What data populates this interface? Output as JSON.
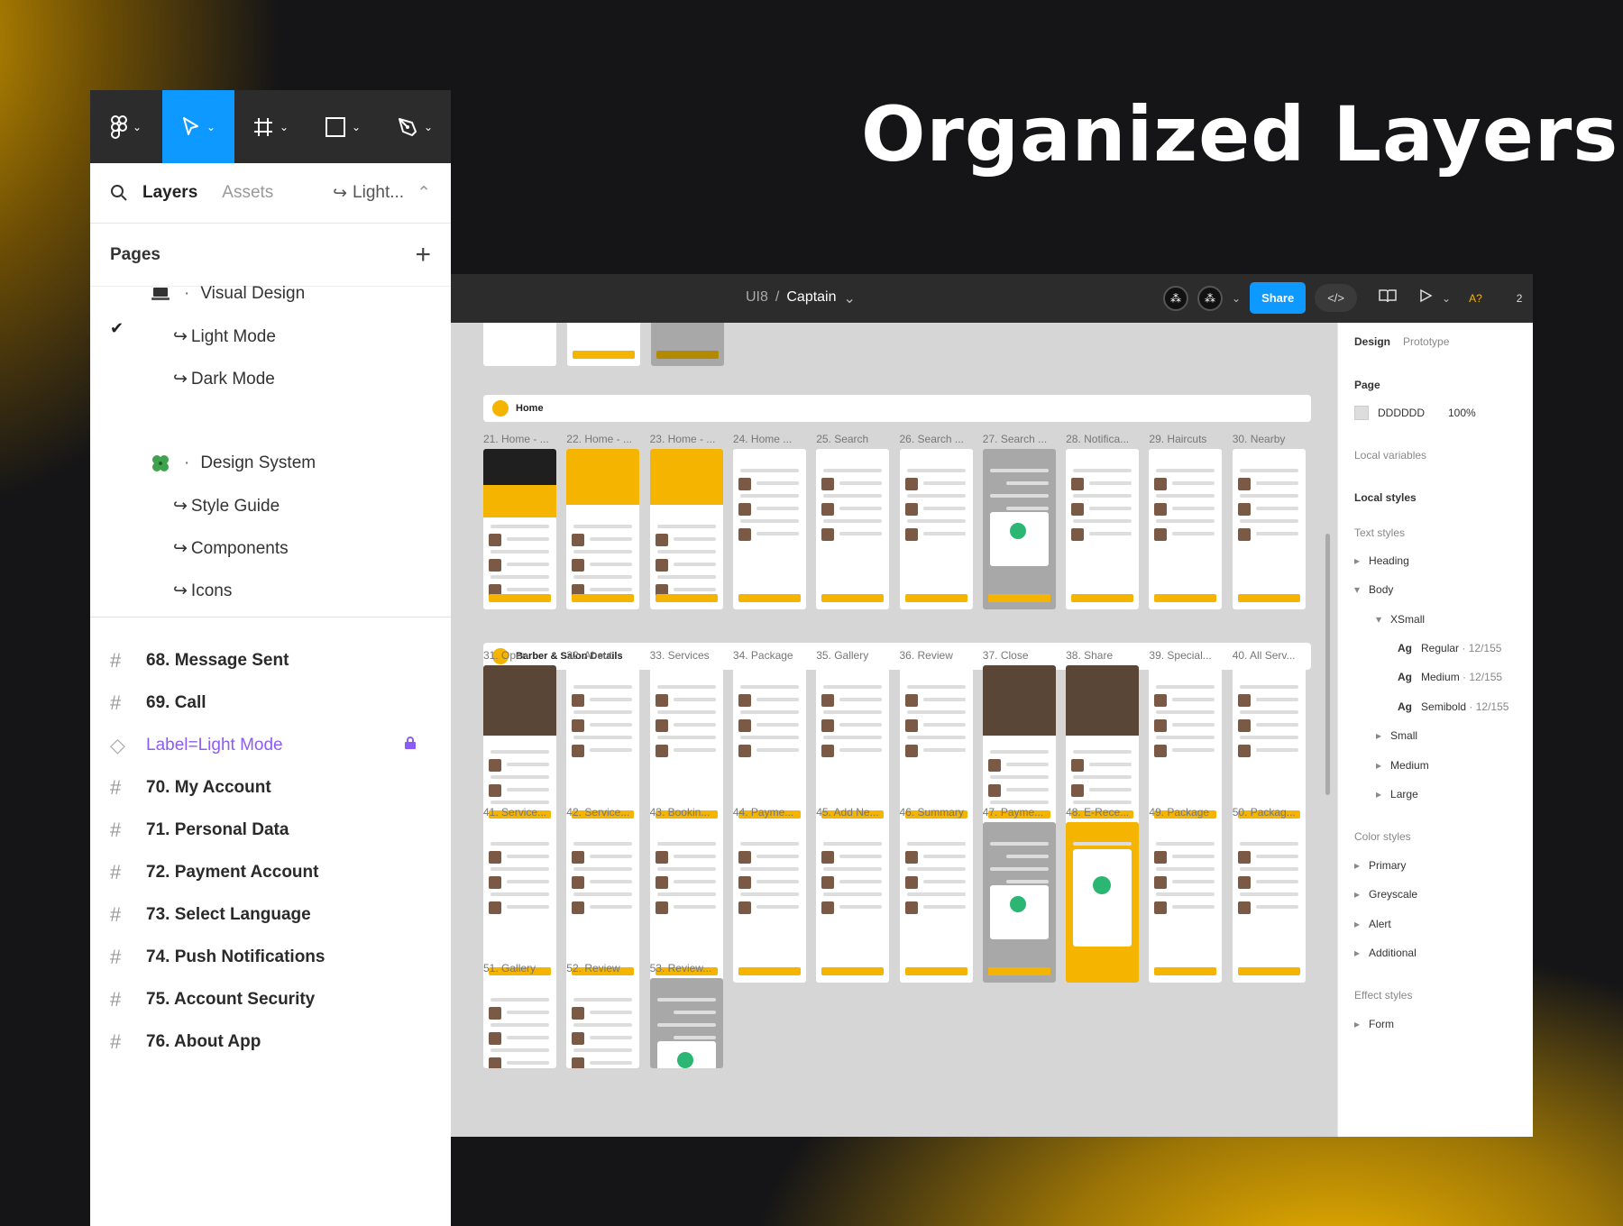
{
  "headline": "Organized Layers",
  "panel": {
    "tabs": {
      "layers": "Layers",
      "assets": "Assets",
      "page": "Light..."
    },
    "pages_title": "Pages",
    "pages": [
      {
        "label": "Visual Design",
        "kind": "group"
      },
      {
        "label": "Light Mode",
        "kind": "sub",
        "checked": true
      },
      {
        "label": "Dark Mode",
        "kind": "sub"
      },
      {
        "label": "Design System",
        "kind": "group"
      },
      {
        "label": "Style Guide",
        "kind": "sub"
      },
      {
        "label": "Components",
        "kind": "sub"
      },
      {
        "label": "Icons",
        "kind": "sub"
      }
    ],
    "layers": [
      "68. Message Sent",
      "69. Call",
      "Label=Light Mode",
      "70. My Account",
      "71. Personal Data",
      "72. Payment Account",
      "73. Select Language",
      "74. Push Notifications",
      "75. Account Security",
      "76. About App"
    ]
  },
  "window": {
    "crumb_team": "UI8",
    "crumb_file": "Captain",
    "share": "Share",
    "code": "</>",
    "zoom_tag": "A?",
    "extra": "2",
    "sections": [
      "Home",
      "Barber & Salon Details"
    ],
    "row1": [
      "21. Home - ...",
      "22. Home - ...",
      "23. Home - ...",
      "24. Home ...",
      "25. Search",
      "26. Search ...",
      "27. Search ...",
      "28. Notifica...",
      "29. Haircuts",
      "30. Nearby"
    ],
    "row2": [
      "31. Open",
      "32. About",
      "33. Services",
      "34. Package",
      "35. Gallery",
      "36. Review",
      "37. Close",
      "38. Share",
      "39. Special...",
      "40. All Serv..."
    ],
    "row3": [
      "41. Service...",
      "42. Service...",
      "43. Bookin...",
      "44. Payme...",
      "45. Add Ne...",
      "46. Summary",
      "47. Payme...",
      "48. E-Rece...",
      "49. Package",
      "50. Packag..."
    ],
    "row4": [
      "51. Gallery",
      "52. Review",
      "53. Review..."
    ],
    "sidebar": {
      "tab_design": "Design",
      "tab_prototype": "Prototype",
      "page": "Page",
      "page_color": "DDDDDD",
      "page_opacity": "100%",
      "local_variables": "Local variables",
      "local_styles": "Local styles",
      "text_styles": "Text styles",
      "heading": "Heading",
      "body": "Body",
      "xsmall": "XSmall",
      "regular": "Regular",
      "regular_meta": "· 12/155",
      "medium": "Medium",
      "medium_meta": "· 12/155",
      "semibold": "Semibold",
      "semibold_meta": "· 12/155",
      "ag": "Ag",
      "small": "Small",
      "medium_size": "Medium",
      "large": "Large",
      "color_styles": "Color styles",
      "primary": "Primary",
      "greyscale": "Greyscale",
      "alert": "Alert",
      "additional": "Additional",
      "effect_styles": "Effect styles",
      "form": "Form"
    }
  },
  "colors": {
    "accent": "#0d99ff",
    "brand": "#f5b400",
    "component": "#8b5cf6"
  }
}
